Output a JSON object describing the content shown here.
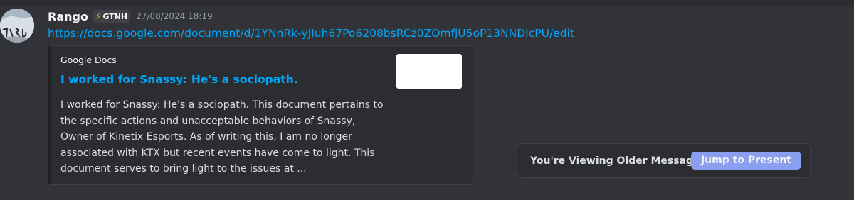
{
  "message": {
    "username": "Rango",
    "badge": {
      "icon": "lightning-icon",
      "glyph": "⚡",
      "label": "GTNH"
    },
    "timestamp": "27/08/2024 18:19",
    "link": "https://docs.google.com/document/d/1YNnRk-yJIuh67Po6208bsRCz0ZOmfjU5oP13NNDIcPU/edit"
  },
  "embed": {
    "provider": "Google Docs",
    "title": "I worked for Snassy: He's a sociopath.",
    "description": "I worked for Snassy: He's a sociopath. This document pertains to the specific actions and unacceptable behaviors of Snassy, Owner of Kinetix Esports. As of writing this, I am no longer associated with KTX but recent events have come to light. This document serves to bring light to the issues at ..."
  },
  "older_messages": {
    "text": "You're Viewing Older Messages",
    "button_label": "Jump to Present"
  },
  "colors": {
    "background": "#313338",
    "link": "#00a8fc",
    "embed_bg": "#2b2d31",
    "button": "#8b9ff0",
    "badge_icon": "#f0b232"
  }
}
